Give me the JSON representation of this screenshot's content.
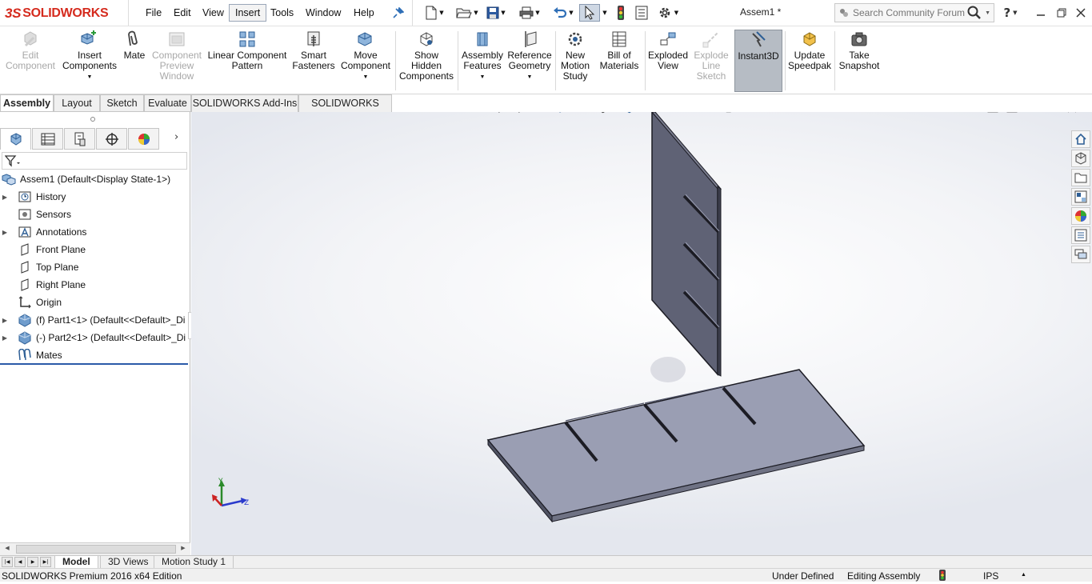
{
  "app": {
    "logo_text": "SOLIDWORKS",
    "logo_prefix": "3S",
    "document_title": "Assem1 *"
  },
  "menu": {
    "items": [
      "File",
      "Edit",
      "View",
      "Insert",
      "Tools",
      "Window",
      "Help"
    ],
    "active": "Insert"
  },
  "quick_access": {
    "icons": [
      "new-document-icon",
      "open-icon",
      "save-icon",
      "print-icon",
      "undo-icon",
      "select-icon",
      "rebuild-icon",
      "file-properties-icon",
      "options-icon"
    ]
  },
  "search": {
    "placeholder": "Search Community Forum"
  },
  "ribbon": {
    "buttons": [
      {
        "label": "Edit\nComponent",
        "enabled": false,
        "icon": "edit-component-icon"
      },
      {
        "label": "Insert\nComponents",
        "enabled": true,
        "icon": "insert-components-icon",
        "dropdown": true
      },
      {
        "label": "Mate",
        "enabled": true,
        "icon": "mate-icon"
      },
      {
        "label": "Component\nPreview\nWindow",
        "enabled": false,
        "icon": "component-preview-icon"
      },
      {
        "label": "Linear Component\nPattern",
        "enabled": true,
        "icon": "linear-pattern-icon"
      },
      {
        "label": "Smart\nFasteners",
        "enabled": true,
        "icon": "smart-fasteners-icon"
      },
      {
        "label": "Move\nComponent",
        "enabled": true,
        "icon": "move-component-icon"
      },
      {
        "label": "Show\nHidden\nComponents",
        "enabled": true,
        "icon": "show-hidden-icon"
      },
      {
        "label": "Assembly\nFeatures",
        "enabled": true,
        "icon": "assembly-features-icon",
        "dropdown": true
      },
      {
        "label": "Reference\nGeometry",
        "enabled": true,
        "icon": "reference-geometry-icon",
        "dropdown": true
      },
      {
        "label": "New\nMotion\nStudy",
        "enabled": true,
        "icon": "motion-study-icon"
      },
      {
        "label": "Bill of\nMaterials",
        "enabled": true,
        "icon": "bill-of-materials-icon"
      },
      {
        "label": "Exploded\nView",
        "enabled": true,
        "icon": "exploded-view-icon"
      },
      {
        "label": "Explode\nLine\nSketch",
        "enabled": false,
        "icon": "explode-line-icon"
      },
      {
        "label": "Instant3D",
        "enabled": true,
        "icon": "instant3d-icon",
        "pressed": true
      },
      {
        "label": "Update\nSpeedpak",
        "enabled": true,
        "icon": "speedpak-icon"
      },
      {
        "label": "Take\nSnapshot",
        "enabled": true,
        "icon": "camera-icon"
      }
    ]
  },
  "command_tabs": [
    "Assembly",
    "Layout",
    "Sketch",
    "Evaluate",
    "SOLIDWORKS Add-Ins",
    "SOLIDWORKS MBD"
  ],
  "active_command_tab": "Assembly",
  "feature_tree": {
    "root": "Assem1  (Default<Display State-1>)",
    "items": [
      {
        "label": "History",
        "icon": "history-icon",
        "expandable": true
      },
      {
        "label": "Sensors",
        "icon": "sensors-icon",
        "expandable": false
      },
      {
        "label": "Annotations",
        "icon": "annotations-icon",
        "expandable": true
      },
      {
        "label": "Front Plane",
        "icon": "plane-icon",
        "expandable": false
      },
      {
        "label": "Top Plane",
        "icon": "plane-icon",
        "expandable": false
      },
      {
        "label": "Right Plane",
        "icon": "plane-icon",
        "expandable": false
      },
      {
        "label": "Origin",
        "icon": "origin-icon",
        "expandable": false
      },
      {
        "label": "(f) Part1<1> (Default<<Default>_Di",
        "icon": "part-icon",
        "expandable": true
      },
      {
        "label": "(-) Part2<1> (Default<<Default>_Di",
        "icon": "part-icon",
        "expandable": true
      },
      {
        "label": "Mates",
        "icon": "mates-icon",
        "expandable": false
      }
    ]
  },
  "bottom_tabs": [
    "Model",
    "3D Views",
    "Motion Study 1"
  ],
  "active_bottom_tab": "Model",
  "status": {
    "edition": "SOLIDWORKS Premium 2016 x64 Edition",
    "definition": "Under Defined",
    "mode": "Editing Assembly",
    "units": "IPS"
  },
  "triad": {
    "y": "Y",
    "z": "Z"
  },
  "colors": {
    "brand": "#d52b1e",
    "part_face": "#9a9eb3",
    "part_face_dark": "#5f6275",
    "selection_blue": "#2a5aa8"
  }
}
